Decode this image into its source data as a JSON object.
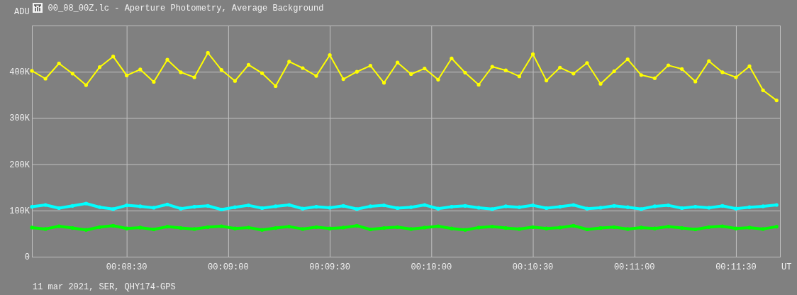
{
  "window": {
    "title": "00_08_00Z.lc - Aperture Photometry, Average Background"
  },
  "chart": {
    "chart_data": {
      "type": "line",
      "ylabel": "ADU",
      "xlabel": "UT",
      "x": [
        482,
        486,
        490,
        494,
        498,
        502,
        506,
        510,
        514,
        518,
        522,
        526,
        530,
        534,
        538,
        542,
        546,
        550,
        554,
        558,
        562,
        566,
        570,
        574,
        578,
        582,
        586,
        590,
        594,
        598,
        602,
        606,
        610,
        614,
        618,
        622,
        626,
        630,
        634,
        638,
        642,
        646,
        650,
        654,
        658,
        662,
        666,
        670,
        674,
        678,
        682,
        686,
        690,
        694,
        698,
        702
      ],
      "series": [
        {
          "color": "#ffff00",
          "values": [
            402,
            385,
            418,
            396,
            371,
            410,
            433,
            392,
            405,
            378,
            426,
            399,
            388,
            441,
            404,
            380,
            415,
            397,
            369,
            422,
            408,
            391,
            436,
            384,
            400,
            413,
            376,
            420,
            395,
            407,
            383,
            429,
            398,
            372,
            411,
            403,
            390,
            438,
            381,
            409,
            396,
            419,
            374,
            401,
            427,
            393,
            386,
            414,
            406,
            379,
            423,
            399,
            388,
            412,
            360,
            338
          ]
        },
        {
          "color": "#00ffff",
          "values": [
            108,
            112,
            105,
            110,
            115,
            107,
            103,
            111,
            109,
            106,
            113,
            104,
            108,
            110,
            102,
            107,
            111,
            105,
            109,
            112,
            104,
            108,
            106,
            110,
            103,
            109,
            111,
            105,
            107,
            112,
            104,
            108,
            110,
            106,
            103,
            109,
            107,
            111,
            105,
            108,
            112,
            104,
            106,
            110,
            107,
            103,
            109,
            111,
            105,
            108,
            106,
            110,
            104,
            107,
            109,
            112
          ]
        },
        {
          "color": "#00ff00",
          "values": [
            63,
            60,
            66,
            62,
            58,
            64,
            67,
            61,
            63,
            59,
            65,
            62,
            60,
            64,
            66,
            61,
            63,
            58,
            62,
            65,
            60,
            64,
            61,
            63,
            67,
            59,
            62,
            64,
            60,
            63,
            66,
            61,
            58,
            63,
            65,
            62,
            60,
            64,
            61,
            63,
            67,
            59,
            62,
            64,
            60,
            63,
            61,
            65,
            62,
            59,
            64,
            66,
            61,
            63,
            60,
            65
          ]
        }
      ],
      "grid": true,
      "xlim": [
        482,
        703
      ],
      "ylim": [
        0,
        500
      ],
      "xticks": [
        {
          "value": 510,
          "label": "00:08:30"
        },
        {
          "value": 540,
          "label": "00:09:00"
        },
        {
          "value": 570,
          "label": "00:09:30"
        },
        {
          "value": 600,
          "label": "00:10:00"
        },
        {
          "value": 630,
          "label": "00:10:30"
        },
        {
          "value": 660,
          "label": "00:11:00"
        },
        {
          "value": 690,
          "label": "00:11:30"
        }
      ],
      "yticks": [
        {
          "value": 0,
          "label": "0"
        },
        {
          "value": 100,
          "label": "100K"
        },
        {
          "value": 200,
          "label": "200K"
        },
        {
          "value": 300,
          "label": "300K"
        },
        {
          "value": 400,
          "label": "400K"
        }
      ]
    }
  },
  "status_bar": {
    "text": "11 mar 2021, SER, QHY174-GPS"
  }
}
